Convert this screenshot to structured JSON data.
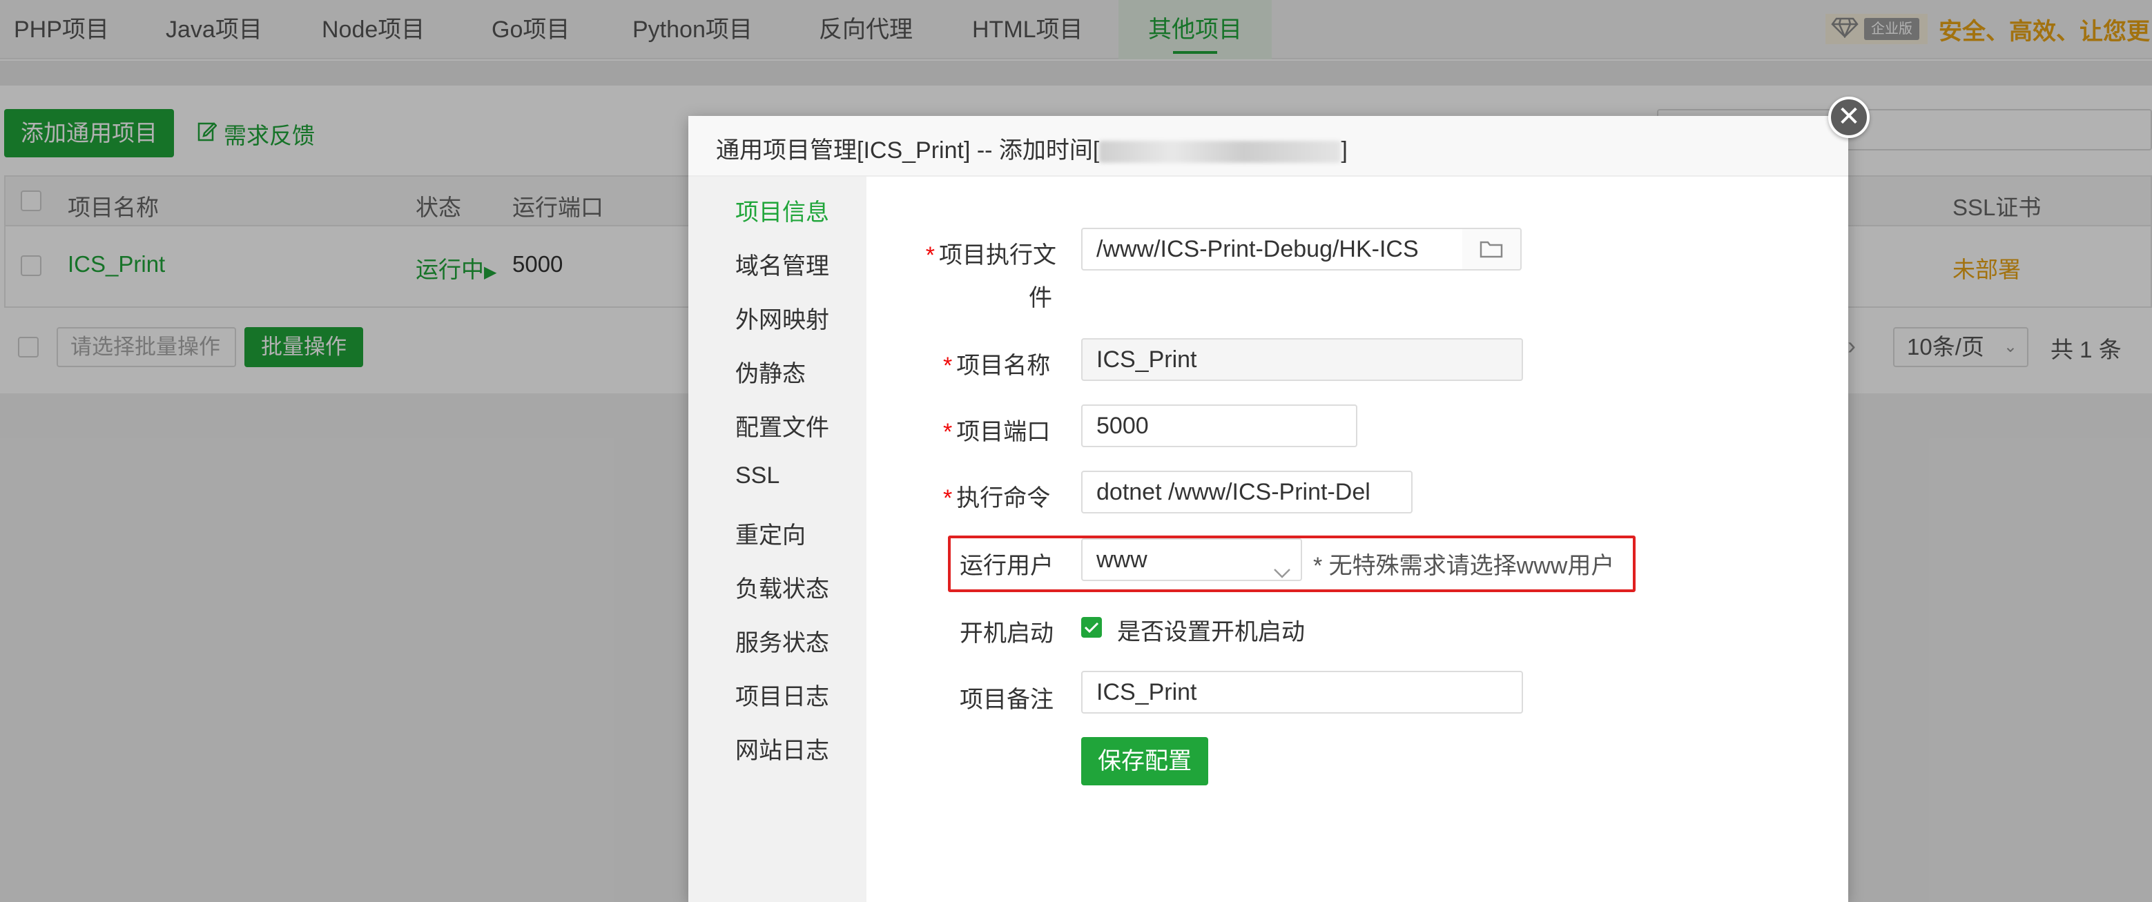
{
  "tabs": [
    {
      "label": "PHP项目",
      "name": "tab-php"
    },
    {
      "label": "Java项目",
      "name": "tab-java"
    },
    {
      "label": "Node项目",
      "name": "tab-node"
    },
    {
      "label": "Go项目",
      "name": "tab-go"
    },
    {
      "label": "Python项目",
      "name": "tab-python"
    },
    {
      "label": "反向代理",
      "name": "tab-reverse-proxy"
    },
    {
      "label": "HTML项目",
      "name": "tab-html"
    },
    {
      "label": "其他项目",
      "name": "tab-other"
    }
  ],
  "header": {
    "enterprise_badge": "企业版",
    "slogan": "安全、高效、让您更"
  },
  "page": {
    "add_button": "添加通用项目",
    "feedback_link": "需求反馈",
    "table": {
      "headers": {
        "name": "项目名称",
        "status": "状态",
        "port": "运行端口",
        "ssl": "SSL证书"
      },
      "row": {
        "name": "ICS_Print",
        "status": "运行中",
        "port": "5000",
        "ssl": "未部署"
      }
    },
    "batch_placeholder": "请选择批量操作",
    "batch_button": "批量操作",
    "pager_size": "10条/页",
    "pager_total": "共 1 条"
  },
  "modal": {
    "title": "通用项目管理[ICS_Print] -- 添加时间[",
    "title_suffix": "]",
    "menu": [
      "项目信息",
      "域名管理",
      "外网映射",
      "伪静态",
      "配置文件",
      "SSL",
      "重定向",
      "负载状态",
      "服务状态",
      "项目日志",
      "网站日志"
    ],
    "form": {
      "exec_file_label_1": "项目执行文",
      "exec_file_label_2": "件",
      "exec_file_value": "/www/ICS-Print-Debug/HK-ICS",
      "name_label": "项目名称",
      "name_value": "ICS_Print",
      "port_label": "项目端口",
      "port_value": "5000",
      "cmd_label": "执行命令",
      "cmd_value": "dotnet /www/ICS-Print-Del",
      "user_label": "运行用户",
      "user_value": "www",
      "user_hint": "* 无特殊需求请选择www用户",
      "boot_label": "开机启动",
      "boot_checkbox_label": "是否设置开机启动",
      "boot_checked": true,
      "remark_label": "项目备注",
      "remark_value": "ICS_Print",
      "save_button": "保存配置"
    }
  },
  "colors": {
    "accent": "#20a53a",
    "warning": "#e9a416",
    "highlight_border": "#e02020"
  }
}
